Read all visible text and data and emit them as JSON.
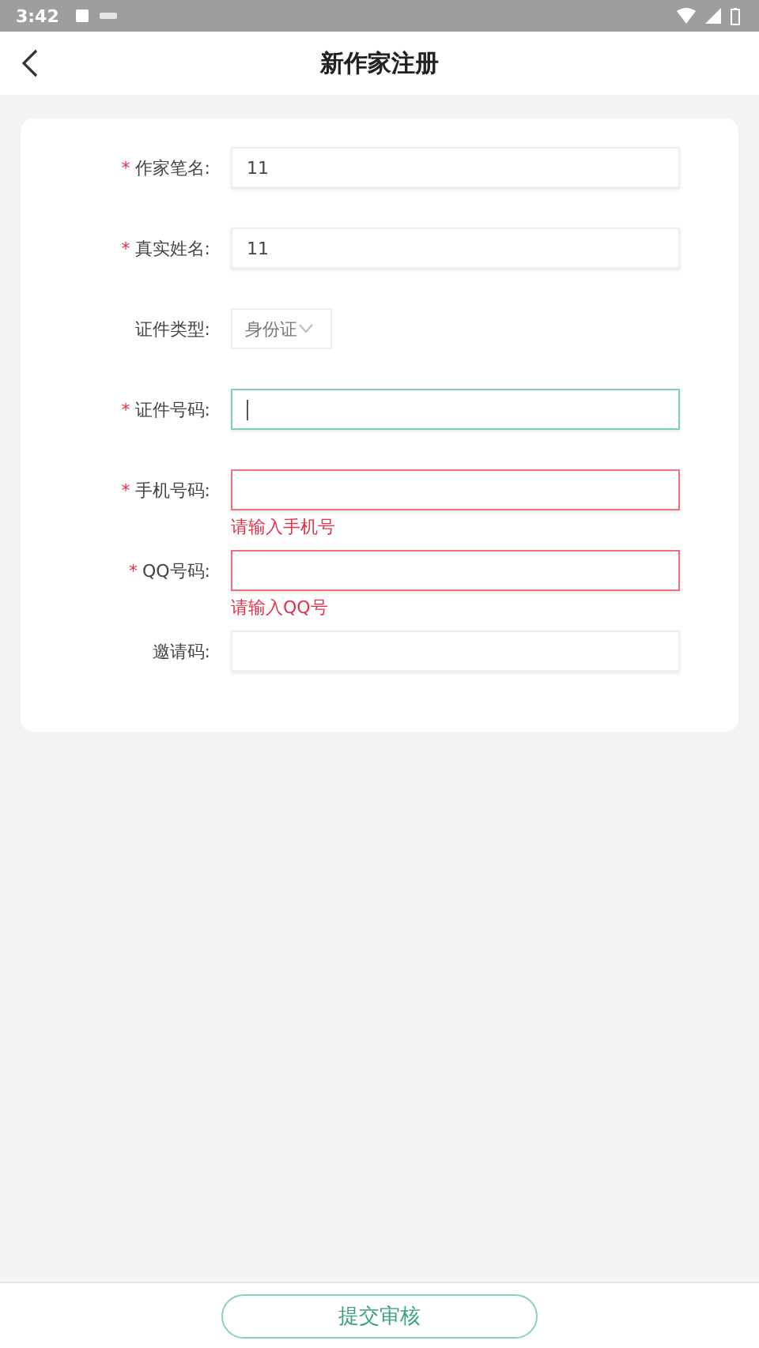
{
  "status_bar": {
    "time": "3:42"
  },
  "header": {
    "title": "新作家注册"
  },
  "form": {
    "fields": [
      {
        "kind": "text",
        "mark": "*",
        "label": "作家笔名:",
        "value": "11",
        "focused": false,
        "invalid": false
      },
      {
        "kind": "text",
        "mark": "*",
        "label": "真实姓名:",
        "value": "11",
        "focused": false,
        "invalid": false
      },
      {
        "kind": "select",
        "label": "证件类型:",
        "value": "身份证"
      },
      {
        "kind": "text",
        "mark": "*",
        "label": "证件号码:",
        "focused": true,
        "invalid": false
      },
      {
        "kind": "text",
        "mark": "*",
        "label": "手机号码:",
        "focused": false,
        "invalid": true,
        "error": "请输入手机号"
      },
      {
        "kind": "text",
        "mark": "*",
        "label": "QQ号码:",
        "focused": false,
        "invalid": true,
        "error": "请输入QQ号"
      },
      {
        "kind": "text",
        "label": "邀请码:",
        "focused": false,
        "invalid": false
      }
    ]
  },
  "submit_button": {
    "label": "提交审核"
  }
}
